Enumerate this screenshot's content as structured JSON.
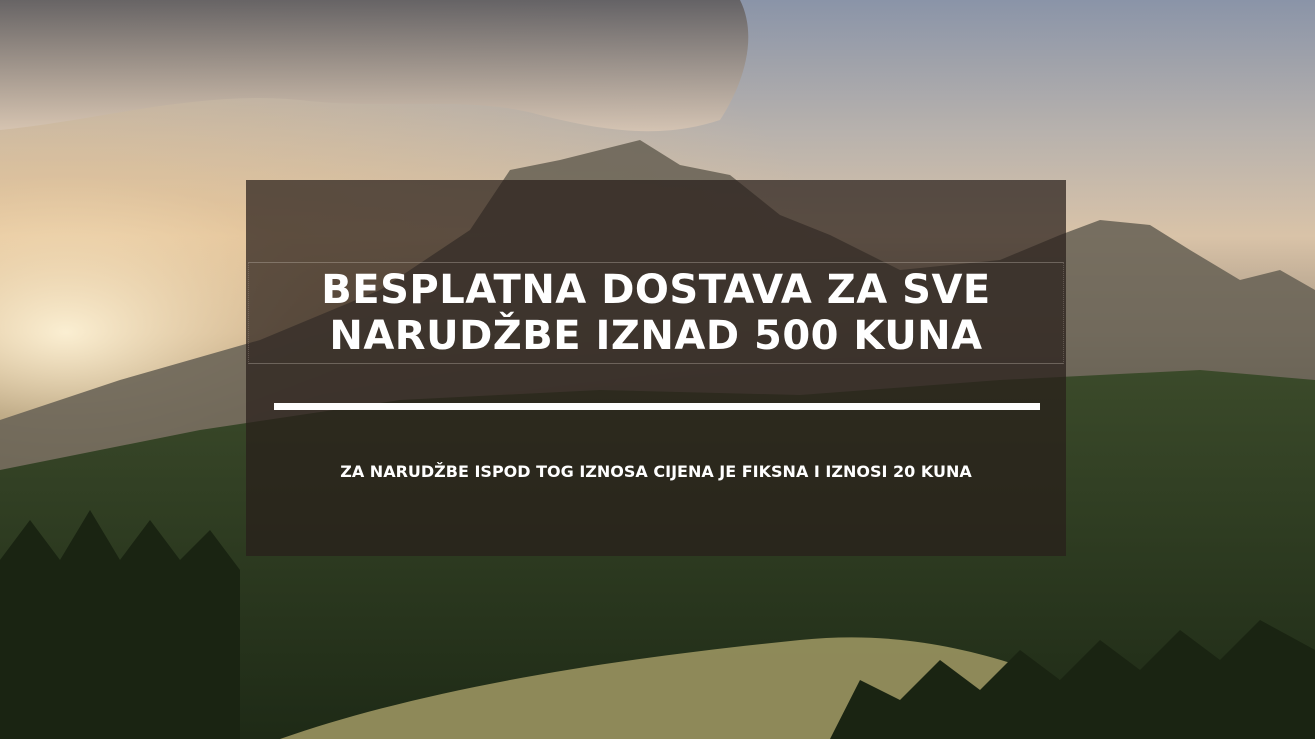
{
  "banner": {
    "headline": "BESPLATNA DOSTAVA ZA SVE NARUDŽBE IZNAD 500 KUNA",
    "subline": "ZA NARUDŽBE ISPOD TOG IZNOSA CIJENA JE FIKSNA I IZNOSI 20 KUNA"
  },
  "colors": {
    "banner_overlay": "#281e1a",
    "text": "#ffffff",
    "divider": "#ffffff"
  }
}
